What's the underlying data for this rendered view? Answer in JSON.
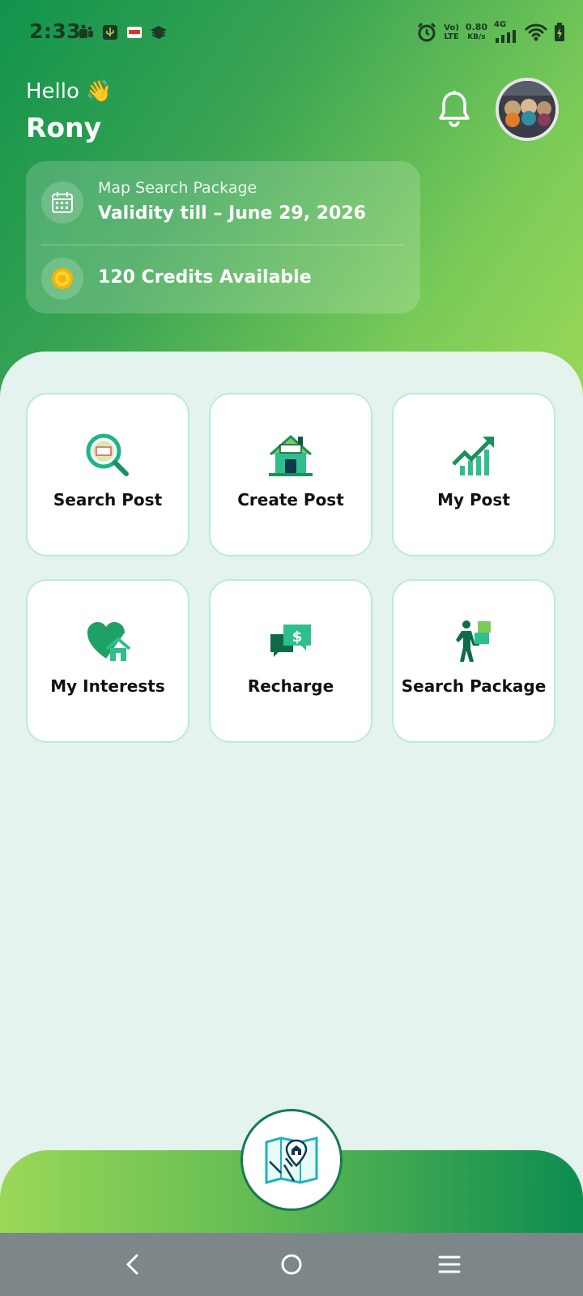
{
  "status_bar": {
    "time": "2:33",
    "volte_top": "Vo)",
    "volte_bottom": "LTE",
    "speed_value": "0.80",
    "speed_unit": "KB/s",
    "network_type": "4G"
  },
  "header": {
    "greeting": "Hello 👋",
    "user_name": "Rony"
  },
  "package_card": {
    "label": "Map Search Package",
    "validity": "Validity till – June 29, 2026",
    "credits": "120 Credits Available"
  },
  "tiles": [
    {
      "label": "Search Post",
      "icon": "search-post-icon"
    },
    {
      "label": "Create Post",
      "icon": "create-post-icon"
    },
    {
      "label": "My Post",
      "icon": "my-post-icon"
    },
    {
      "label": "My Interests",
      "icon": "my-interests-icon"
    },
    {
      "label": "Recharge",
      "icon": "recharge-icon"
    },
    {
      "label": "Search Package",
      "icon": "search-package-icon"
    }
  ],
  "colors": {
    "header_start": "#11934c",
    "header_end": "#9ad858",
    "tile_border": "#b9ecd7",
    "sheet_bg": "#e4f3ee",
    "accent_dark": "#147a52"
  }
}
